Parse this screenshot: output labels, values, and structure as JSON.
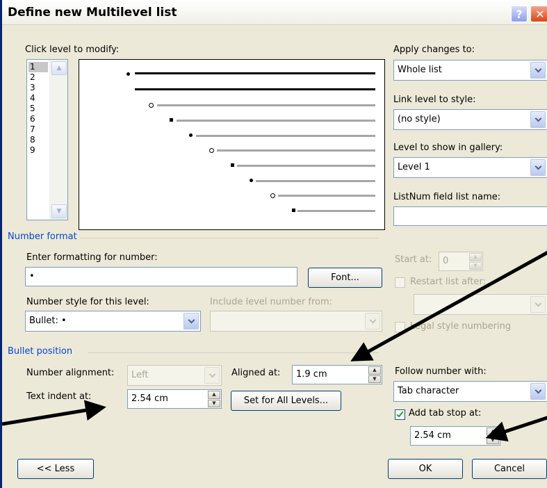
{
  "dialog": {
    "title": "Define new Multilevel list",
    "help_label": "?",
    "close_label": "✕"
  },
  "levels": {
    "label": "Click level to modify:",
    "items": [
      "1",
      "2",
      "3",
      "4",
      "5",
      "6",
      "7",
      "8",
      "9"
    ],
    "selected": "1"
  },
  "right_panel": {
    "apply_label": "Apply changes to:",
    "apply_value": "Whole list",
    "link_label": "Link level to style:",
    "link_value": "(no style)",
    "gallery_label": "Level to show in gallery:",
    "gallery_value": "Level 1",
    "listnum_label": "ListNum field list name:",
    "listnum_value": ""
  },
  "number_format": {
    "section_title": "Number format",
    "enter_label": "Enter formatting for number:",
    "enter_value": "•",
    "font_button": "Font...",
    "style_label": "Number style for this level:",
    "style_value": "Bullet: •",
    "include_label": "Include level number from:",
    "include_value": "",
    "start_label": "Start at:",
    "start_value": "0",
    "restart_label": "Restart list after:",
    "restart_value": "",
    "legal_label": "Legal style numbering"
  },
  "bullet_position": {
    "section_title": "Bullet position",
    "alignment_label": "Number alignment:",
    "alignment_value": "Left",
    "aligned_at_label": "Aligned at:",
    "aligned_at_value": "1.9 cm",
    "indent_label": "Text indent at:",
    "indent_value": "2.54 cm",
    "set_all_button": "Set for All Levels...",
    "follow_label": "Follow number with:",
    "follow_value": "Tab character",
    "tabstop_label": "Add tab stop at:",
    "tabstop_checked": true,
    "tabstop_value": "2.54 cm"
  },
  "footer": {
    "less_button": "<< Less",
    "ok_button": "OK",
    "cancel_button": "Cancel"
  },
  "colors": {
    "section_title": "#0046d5",
    "dialog_bg": "#ece9d8",
    "preview_active": "#000000",
    "preview_inactive": "#a6a6a6"
  }
}
